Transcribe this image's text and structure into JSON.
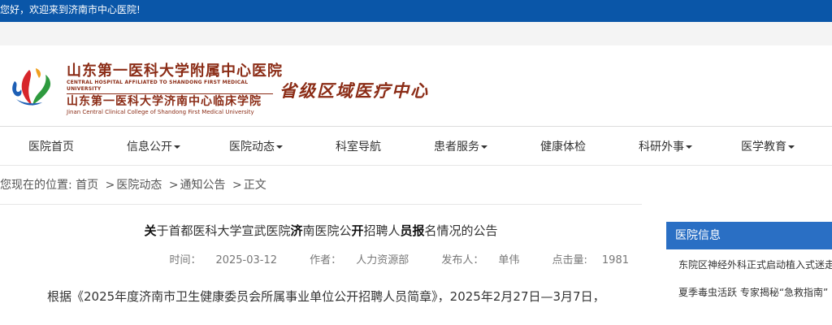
{
  "topbar": {
    "welcome": "您好，欢迎来到济南市中心医院!"
  },
  "header": {
    "cn_name": "山东第一医科大学附属中心医院",
    "en_name": "CENTRAL HOSPITAL AFFILIATED TO SHANDONG FIRST MEDICAL UNIVERSITY",
    "cn_college": "山东第一医科大学济南中心临床学院",
    "en_college": "Jinan Central Clinical College of Shandong First Medical University",
    "slogan": "省级区域医疗中心",
    "brand_color": "#8b2c16"
  },
  "nav": {
    "items": [
      {
        "label": "医院首页",
        "dropdown": false
      },
      {
        "label": "信息公开",
        "dropdown": true
      },
      {
        "label": "医院动态",
        "dropdown": true
      },
      {
        "label": "科室导航",
        "dropdown": false
      },
      {
        "label": "患者服务",
        "dropdown": true
      },
      {
        "label": "健康体检",
        "dropdown": false
      },
      {
        "label": "科研外事",
        "dropdown": true
      },
      {
        "label": "医学教育",
        "dropdown": true
      }
    ]
  },
  "breadcrumb": {
    "prefix": "您现在的位置:",
    "items": [
      "首页",
      "医院动态",
      "通知公告",
      "正文"
    ],
    "separator": ">"
  },
  "article": {
    "title_parts": [
      "关",
      "于首都医科大学宣武医院",
      "济",
      "南医院公",
      "开",
      "招聘人",
      "员报",
      "名情况的公告"
    ],
    "meta": {
      "time_label": "时间：",
      "time": "2025-03-12",
      "author_label": "作者：",
      "author": "人力资源部",
      "publisher_label": "发布人：",
      "publisher": "单伟",
      "clicks_label": "点击量:",
      "clicks": "1981"
    },
    "body": "根据《2025年度济南市卫生健康委员会所属事业单位公开招聘人员简章》，2025年2月27日—3月7日，"
  },
  "sidebar": {
    "heading": "医院信息",
    "items": [
      "东院区神经外科正式启动植入式迷走神经刺激术",
      "夏季毒虫活跃 专家揭秘“急救指南”"
    ]
  },
  "colors": {
    "topbar": "#0a56a8",
    "side_head": "#2a6fc4"
  }
}
